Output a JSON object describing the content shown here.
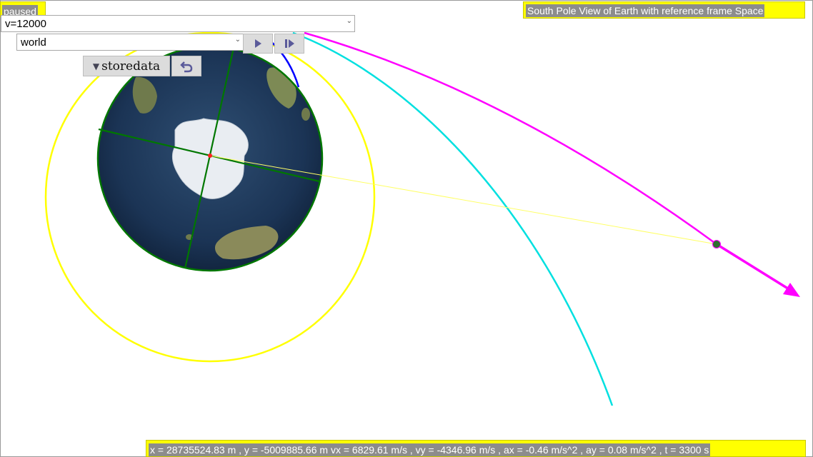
{
  "status": {
    "paused": "paused"
  },
  "view_title": "South Pole View of Earth with reference frame Space",
  "controls": {
    "velocity_select": "v=12000",
    "frame_select": "world",
    "store_label": "storedata"
  },
  "readout": "x = 28735524.83 m , y = -5009885.66 m vx = 6829.61 m/s , vy = -4346.96 m/s , ax = -0.46 m/s^2 , ay = 0.08 m/s^2 , t = 3300 s",
  "icons": {
    "play": "play-icon",
    "step": "step-forward-icon",
    "store": "dropdown-triangle-icon",
    "undo": "undo-icon"
  },
  "colors": {
    "label_bg": "#ffff00",
    "label_text_bg": "#8c8c8c",
    "orbit_ring": "#ffff00",
    "earth_grid": "#007700",
    "trajectory_magenta": "#ff00ff",
    "trajectory_cyan": "#00e5e5",
    "trajectory_blue": "#0000ff",
    "button_icon": "#5a5a9a"
  }
}
